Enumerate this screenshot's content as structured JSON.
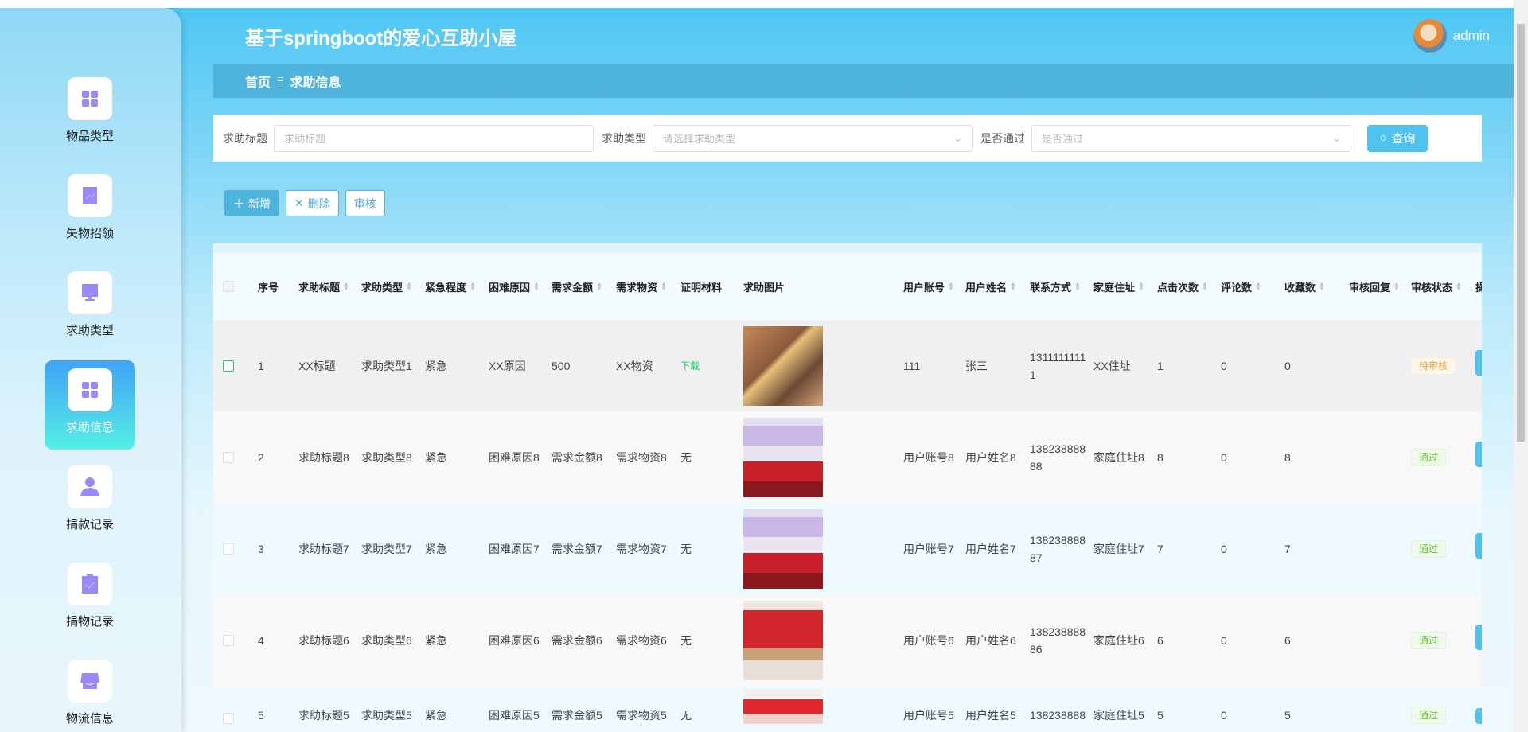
{
  "app": {
    "title": "基于springboot的爱心互助小屋",
    "user": "admin"
  },
  "sidebar": {
    "items": [
      {
        "label": "物品类型",
        "icon": "grid-icon"
      },
      {
        "label": "失物招领",
        "icon": "chart-icon"
      },
      {
        "label": "求助类型",
        "icon": "monitor-icon"
      },
      {
        "label": "求助信息",
        "icon": "grid-icon",
        "active": true
      },
      {
        "label": "捐款记录",
        "icon": "user-icon"
      },
      {
        "label": "捐物记录",
        "icon": "clipboard-icon"
      },
      {
        "label": "物流信息",
        "icon": "box-icon"
      }
    ]
  },
  "breadcrumb": {
    "home": "首页",
    "sep": "Ξ",
    "current": "求助信息"
  },
  "search": {
    "title_label": "求助标题",
    "title_placeholder": "求助标题",
    "type_label": "求助类型",
    "type_placeholder": "请选择求助类型",
    "pass_label": "是否通过",
    "pass_placeholder": "是否通过",
    "query_label": "查询"
  },
  "actions": {
    "add": "新增",
    "delete": "删除",
    "review": "审核"
  },
  "colors": {
    "accent": "#4fc3ee",
    "header": "#4eb4dc",
    "pass": "#67c23a",
    "pending": "#e6a23c",
    "download": "#13ce66"
  },
  "table": {
    "columns": [
      "序号",
      "求助标题",
      "求助类型",
      "紧急程度",
      "困难原因",
      "需求金额",
      "需求物资",
      "证明材料",
      "求助图片",
      "用户账号",
      "用户姓名",
      "联系方式",
      "家庭住址",
      "点击次数",
      "评论数",
      "收藏数",
      "审核回复",
      "审核状态",
      "操"
    ],
    "rows": [
      {
        "no": "1",
        "title": "XX标题",
        "type": "求助类型1",
        "urgency": "紧急",
        "reason": "XX原因",
        "amount": "500",
        "goods": "XX物资",
        "proof": "下载",
        "account": "111",
        "name": "张三",
        "phone": "13111111111",
        "address": "XX住址",
        "clicks": "1",
        "comments": "0",
        "favorites": "0",
        "reply": "",
        "status": "待审核"
      },
      {
        "no": "2",
        "title": "求助标题8",
        "type": "求助类型8",
        "urgency": "紧急",
        "reason": "困难原因8",
        "amount": "需求金额8",
        "goods": "需求物资8",
        "proof": "无",
        "account": "用户账号8",
        "name": "用户姓名8",
        "phone": "13823888888",
        "address": "家庭住址8",
        "clicks": "8",
        "comments": "0",
        "favorites": "8",
        "reply": "",
        "status": "通过"
      },
      {
        "no": "3",
        "title": "求助标题7",
        "type": "求助类型7",
        "urgency": "紧急",
        "reason": "困难原因7",
        "amount": "需求金额7",
        "goods": "需求物资7",
        "proof": "无",
        "account": "用户账号7",
        "name": "用户姓名7",
        "phone": "13823888887",
        "address": "家庭住址7",
        "clicks": "7",
        "comments": "0",
        "favorites": "7",
        "reply": "",
        "status": "通过"
      },
      {
        "no": "4",
        "title": "求助标题6",
        "type": "求助类型6",
        "urgency": "紧急",
        "reason": "困难原因6",
        "amount": "需求金额6",
        "goods": "需求物资6",
        "proof": "无",
        "account": "用户账号6",
        "name": "用户姓名6",
        "phone": "13823888886",
        "address": "家庭住址6",
        "clicks": "6",
        "comments": "0",
        "favorites": "6",
        "reply": "",
        "status": "通过"
      },
      {
        "no": "5",
        "title": "求助标题5",
        "type": "求助类型5",
        "urgency": "紧急",
        "reason": "困难原因5",
        "amount": "需求金额5",
        "goods": "需求物资5",
        "proof": "无",
        "account": "用户账号5",
        "name": "用户姓名5",
        "phone": "138238888",
        "address": "家庭住址5",
        "clicks": "5",
        "comments": "0",
        "favorites": "5",
        "reply": "",
        "status": "通过"
      }
    ]
  }
}
